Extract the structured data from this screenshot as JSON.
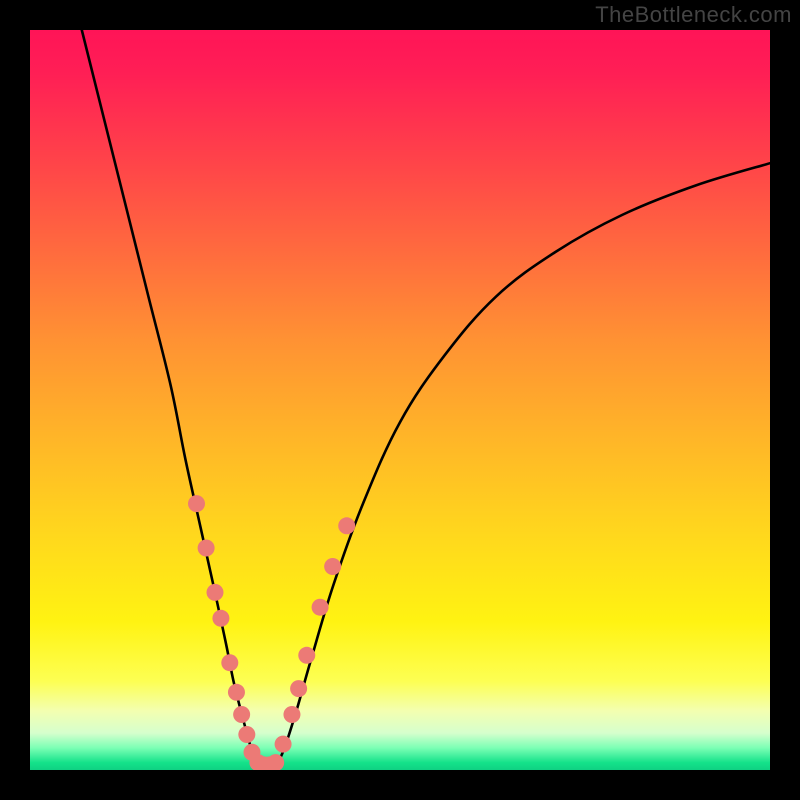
{
  "watermark": "TheBottleneck.com",
  "chart_data": {
    "type": "line",
    "title": "",
    "xlabel": "",
    "ylabel": "",
    "xlim": [
      0,
      100
    ],
    "ylim": [
      0,
      100
    ],
    "series": [
      {
        "name": "curve-left",
        "x": [
          7,
          10,
          13,
          16,
          19,
          21,
          23,
          25,
          26.5,
          27.5,
          28.5,
          29.3,
          30.0,
          30.6
        ],
        "y": [
          100,
          88,
          76,
          64,
          52,
          42,
          33,
          24,
          17,
          12,
          8,
          5,
          2.5,
          0.8
        ]
      },
      {
        "name": "curve-right",
        "x": [
          33.4,
          34.4,
          36,
          38,
          41,
          45,
          50,
          56,
          63,
          71,
          80,
          90,
          100
        ],
        "y": [
          0.8,
          3,
          8,
          15,
          25,
          36,
          47,
          56,
          64,
          70,
          75,
          79,
          82
        ]
      },
      {
        "name": "valley-floor",
        "x": [
          30.6,
          31.5,
          32.5,
          33.4
        ],
        "y": [
          0.8,
          0.6,
          0.6,
          0.8
        ]
      }
    ],
    "markers": {
      "name": "dots",
      "color": "#ec7a76",
      "points": [
        {
          "x": 22.5,
          "y": 36
        },
        {
          "x": 23.8,
          "y": 30
        },
        {
          "x": 25.0,
          "y": 24
        },
        {
          "x": 25.8,
          "y": 20.5
        },
        {
          "x": 27.0,
          "y": 14.5
        },
        {
          "x": 27.9,
          "y": 10.5
        },
        {
          "x": 28.6,
          "y": 7.5
        },
        {
          "x": 29.3,
          "y": 4.8
        },
        {
          "x": 30.0,
          "y": 2.4
        },
        {
          "x": 30.8,
          "y": 1.0
        },
        {
          "x": 31.6,
          "y": 0.7
        },
        {
          "x": 32.4,
          "y": 0.7
        },
        {
          "x": 33.2,
          "y": 1.0
        },
        {
          "x": 34.2,
          "y": 3.5
        },
        {
          "x": 35.4,
          "y": 7.5
        },
        {
          "x": 36.3,
          "y": 11
        },
        {
          "x": 37.4,
          "y": 15.5
        },
        {
          "x": 39.2,
          "y": 22
        },
        {
          "x": 40.9,
          "y": 27.5
        },
        {
          "x": 42.8,
          "y": 33
        }
      ]
    }
  }
}
